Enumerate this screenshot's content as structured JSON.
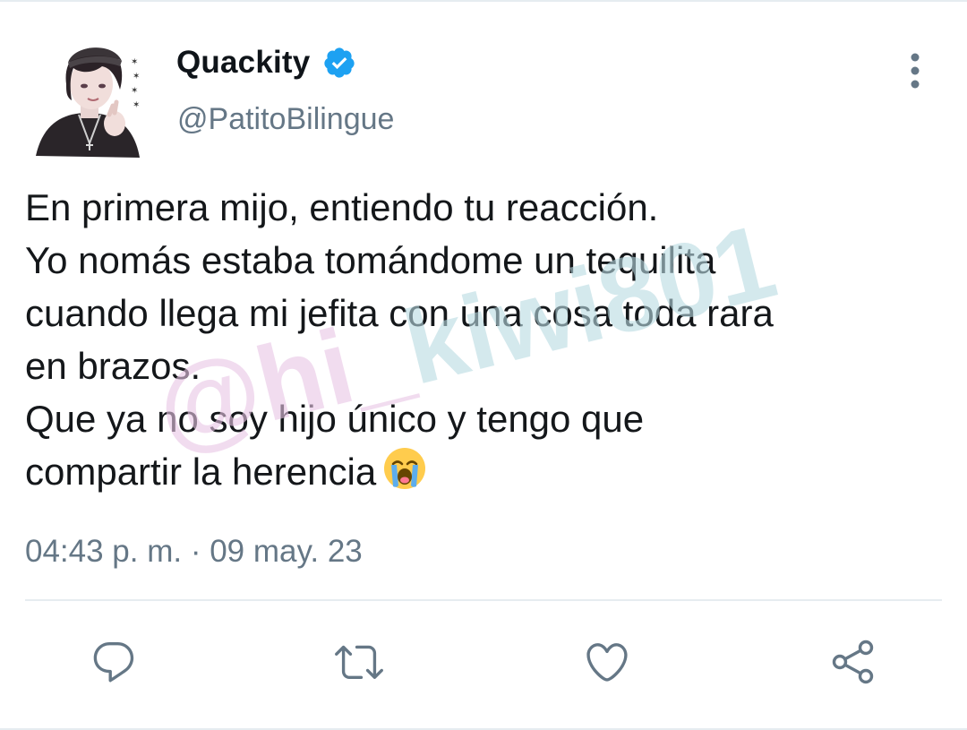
{
  "tweet": {
    "display_name": "Quackity",
    "handle": "@PatitoBilingue",
    "text_lines": [
      "En primera mijo, entiendo tu reacción.",
      "Yo nomás estaba tomándome un tequilita",
      "cuando llega mi jefita con una cosa toda rara",
      "en brazos.",
      "Que ya no soy hijo único y tengo que",
      "compartir la herencia"
    ],
    "emoji": "loudly-crying-face",
    "timestamp": "04:43 p. m. · 09 may. 23"
  },
  "watermark": {
    "part_a": "@hi_",
    "part_b": "kiwi801"
  },
  "icons": {
    "verified": "verified-badge-icon",
    "more": "more-vertical-icon",
    "reply": "reply-icon",
    "retweet": "retweet-icon",
    "like": "heart-icon",
    "share": "share-icon"
  },
  "colors": {
    "accent": "#1da1f2",
    "icon_gray": "#657786",
    "text": "#14171a"
  }
}
